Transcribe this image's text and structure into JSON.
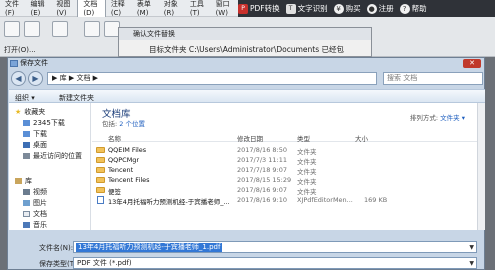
{
  "app": {
    "menus": [
      "文件(F)",
      "编辑(E)",
      "视图(V)",
      "文档(D)",
      "注释(C)",
      "表单(M)",
      "对象(R)",
      "工具(T)",
      "窗口(W)"
    ],
    "active_menu_index": 3,
    "right_items": [
      "PDF转换",
      "文字识别",
      "购买",
      "注册",
      "帮助"
    ],
    "toolbar_open_label": "打开(O)..."
  },
  "confirm_dialog": {
    "title": "确认文件替换",
    "message": "目标文件夹 C:\\Users\\Administrator\\Documents 已经包"
  },
  "save_dialog": {
    "title": "保存文件",
    "address": "▶ 库 ▶ 文档 ▶",
    "search_placeholder": "搜索 文档",
    "organize_label": "组织 ▾",
    "new_folder_label": "新建文件夹",
    "nav": {
      "favorites_header": "收藏夹",
      "favorites": [
        "2345下载",
        "下载",
        "桌面",
        "最近访问的位置"
      ],
      "library_header": "库",
      "libraries": [
        "视频",
        "图片",
        "文档",
        "音乐"
      ]
    },
    "library": {
      "title": "文档库",
      "subtitle_prefix": "包括: ",
      "subtitle_link": "2 个位置",
      "arrange_label": "排列方式:",
      "arrange_value": "文件夹 ▾"
    },
    "columns": [
      "名称",
      "修改日期",
      "类型",
      "大小"
    ],
    "rows": [
      {
        "name": "QQEIM Files",
        "date": "2017/8/16 8:50",
        "type": "文件夹",
        "size": "",
        "kind": "folder"
      },
      {
        "name": "QQPCMgr",
        "date": "2017/7/3 11:11",
        "type": "文件夹",
        "size": "",
        "kind": "folder"
      },
      {
        "name": "Tencent",
        "date": "2017/7/18 9:07",
        "type": "文件夹",
        "size": "",
        "kind": "folder"
      },
      {
        "name": "Tencent Files",
        "date": "2017/8/15 15:29",
        "type": "文件夹",
        "size": "",
        "kind": "folder"
      },
      {
        "name": "便签",
        "date": "2017/8/16 9:07",
        "type": "文件夹",
        "size": "",
        "kind": "folder"
      },
      {
        "name": "13年4月托福听力预测机经-于宾播老师_...",
        "date": "2017/8/16 9:10",
        "type": "XJPdfEditorMen...",
        "size": "169 KB",
        "kind": "pdf"
      }
    ],
    "filename_label": "文件名(N):",
    "filename_value": "13年4月托福听力预测机经-于宾播老师_1.pdf",
    "filetype_label": "保存类型(T):",
    "filetype_value": "PDF 文件 (*.pdf)"
  }
}
